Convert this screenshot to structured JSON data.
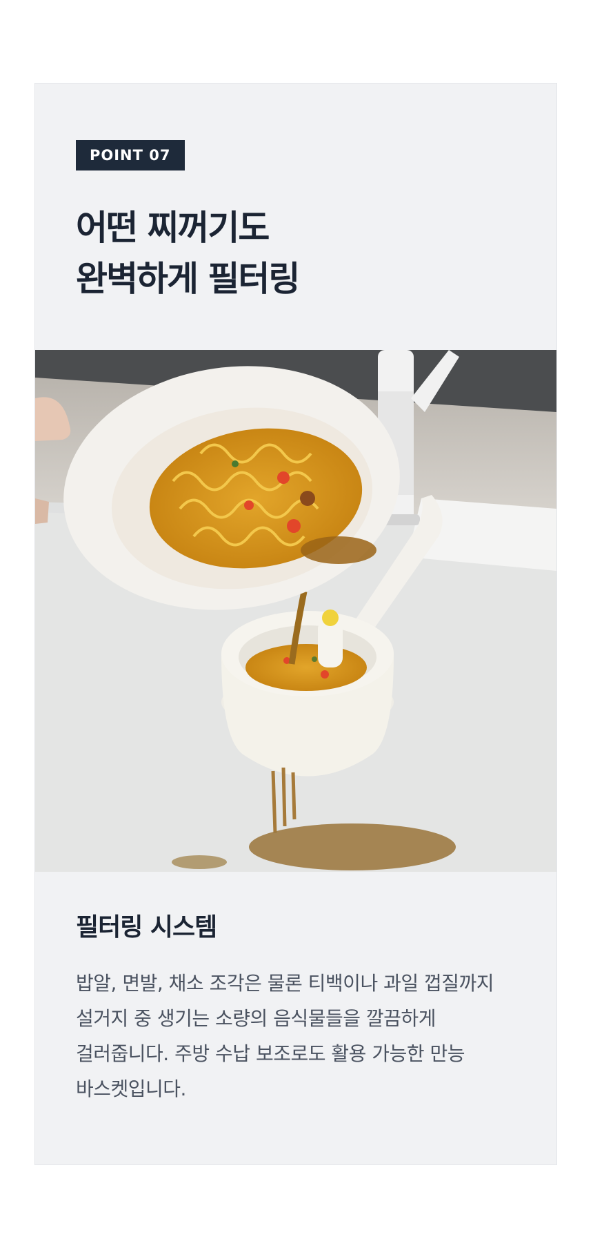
{
  "badge": "POINT 07",
  "headline": {
    "line1": "어떤 찌꺼기도",
    "line2": "완벽하게 필터링"
  },
  "photo": {
    "icon": "noodle-strainer-photo"
  },
  "subtitle": "필터링 시스템",
  "description": {
    "line1": "밥알, 면발, 채소 조각은 물론 티백이나 과일 껍질까지",
    "line2": "설거지 중 생기는 소량의 음식물들을 깔끔하게",
    "line3": "걸러줍니다. 주방 수납 보조로도 활용 가능한 만능",
    "line4": "바스켓입니다."
  },
  "colors": {
    "card_bg": "#f1f2f4",
    "badge_bg": "#1e2a3a",
    "heading": "#1b2433",
    "body_text": "#4a5260"
  }
}
